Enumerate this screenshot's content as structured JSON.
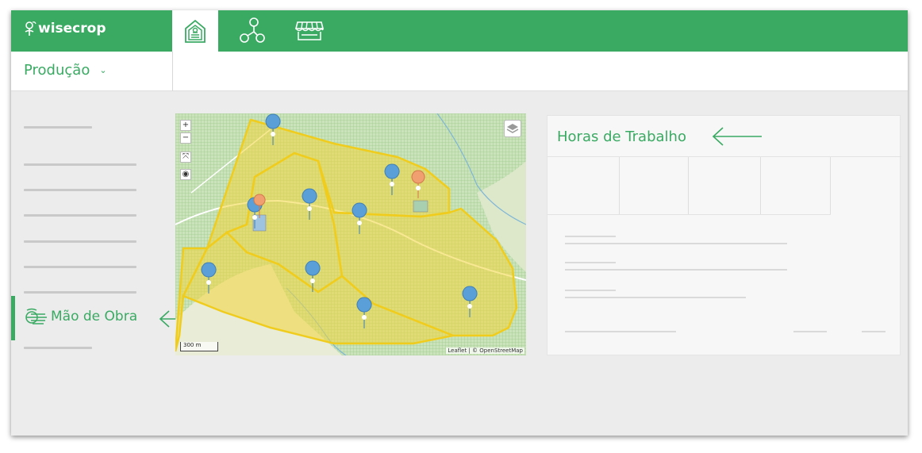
{
  "app": {
    "name": "wisecrop"
  },
  "nav": {
    "tabs": [
      {
        "icon": "greenhouse-icon",
        "active": true
      },
      {
        "icon": "network-icon",
        "active": false
      },
      {
        "icon": "market-stall-icon",
        "active": false
      }
    ]
  },
  "module": {
    "selected": "Produção"
  },
  "sidebar": {
    "active_item": "Mão de Obra"
  },
  "panel": {
    "title": "Horas de Trabalho"
  },
  "map": {
    "scale": "300 m",
    "attribution": "Leaflet | © OpenStreetMap"
  },
  "colors": {
    "brand_green": "#3aaa63",
    "field_yellow": "#f3d53a",
    "marker_blue": "#5b9fd8",
    "marker_orange": "#f0a070"
  }
}
